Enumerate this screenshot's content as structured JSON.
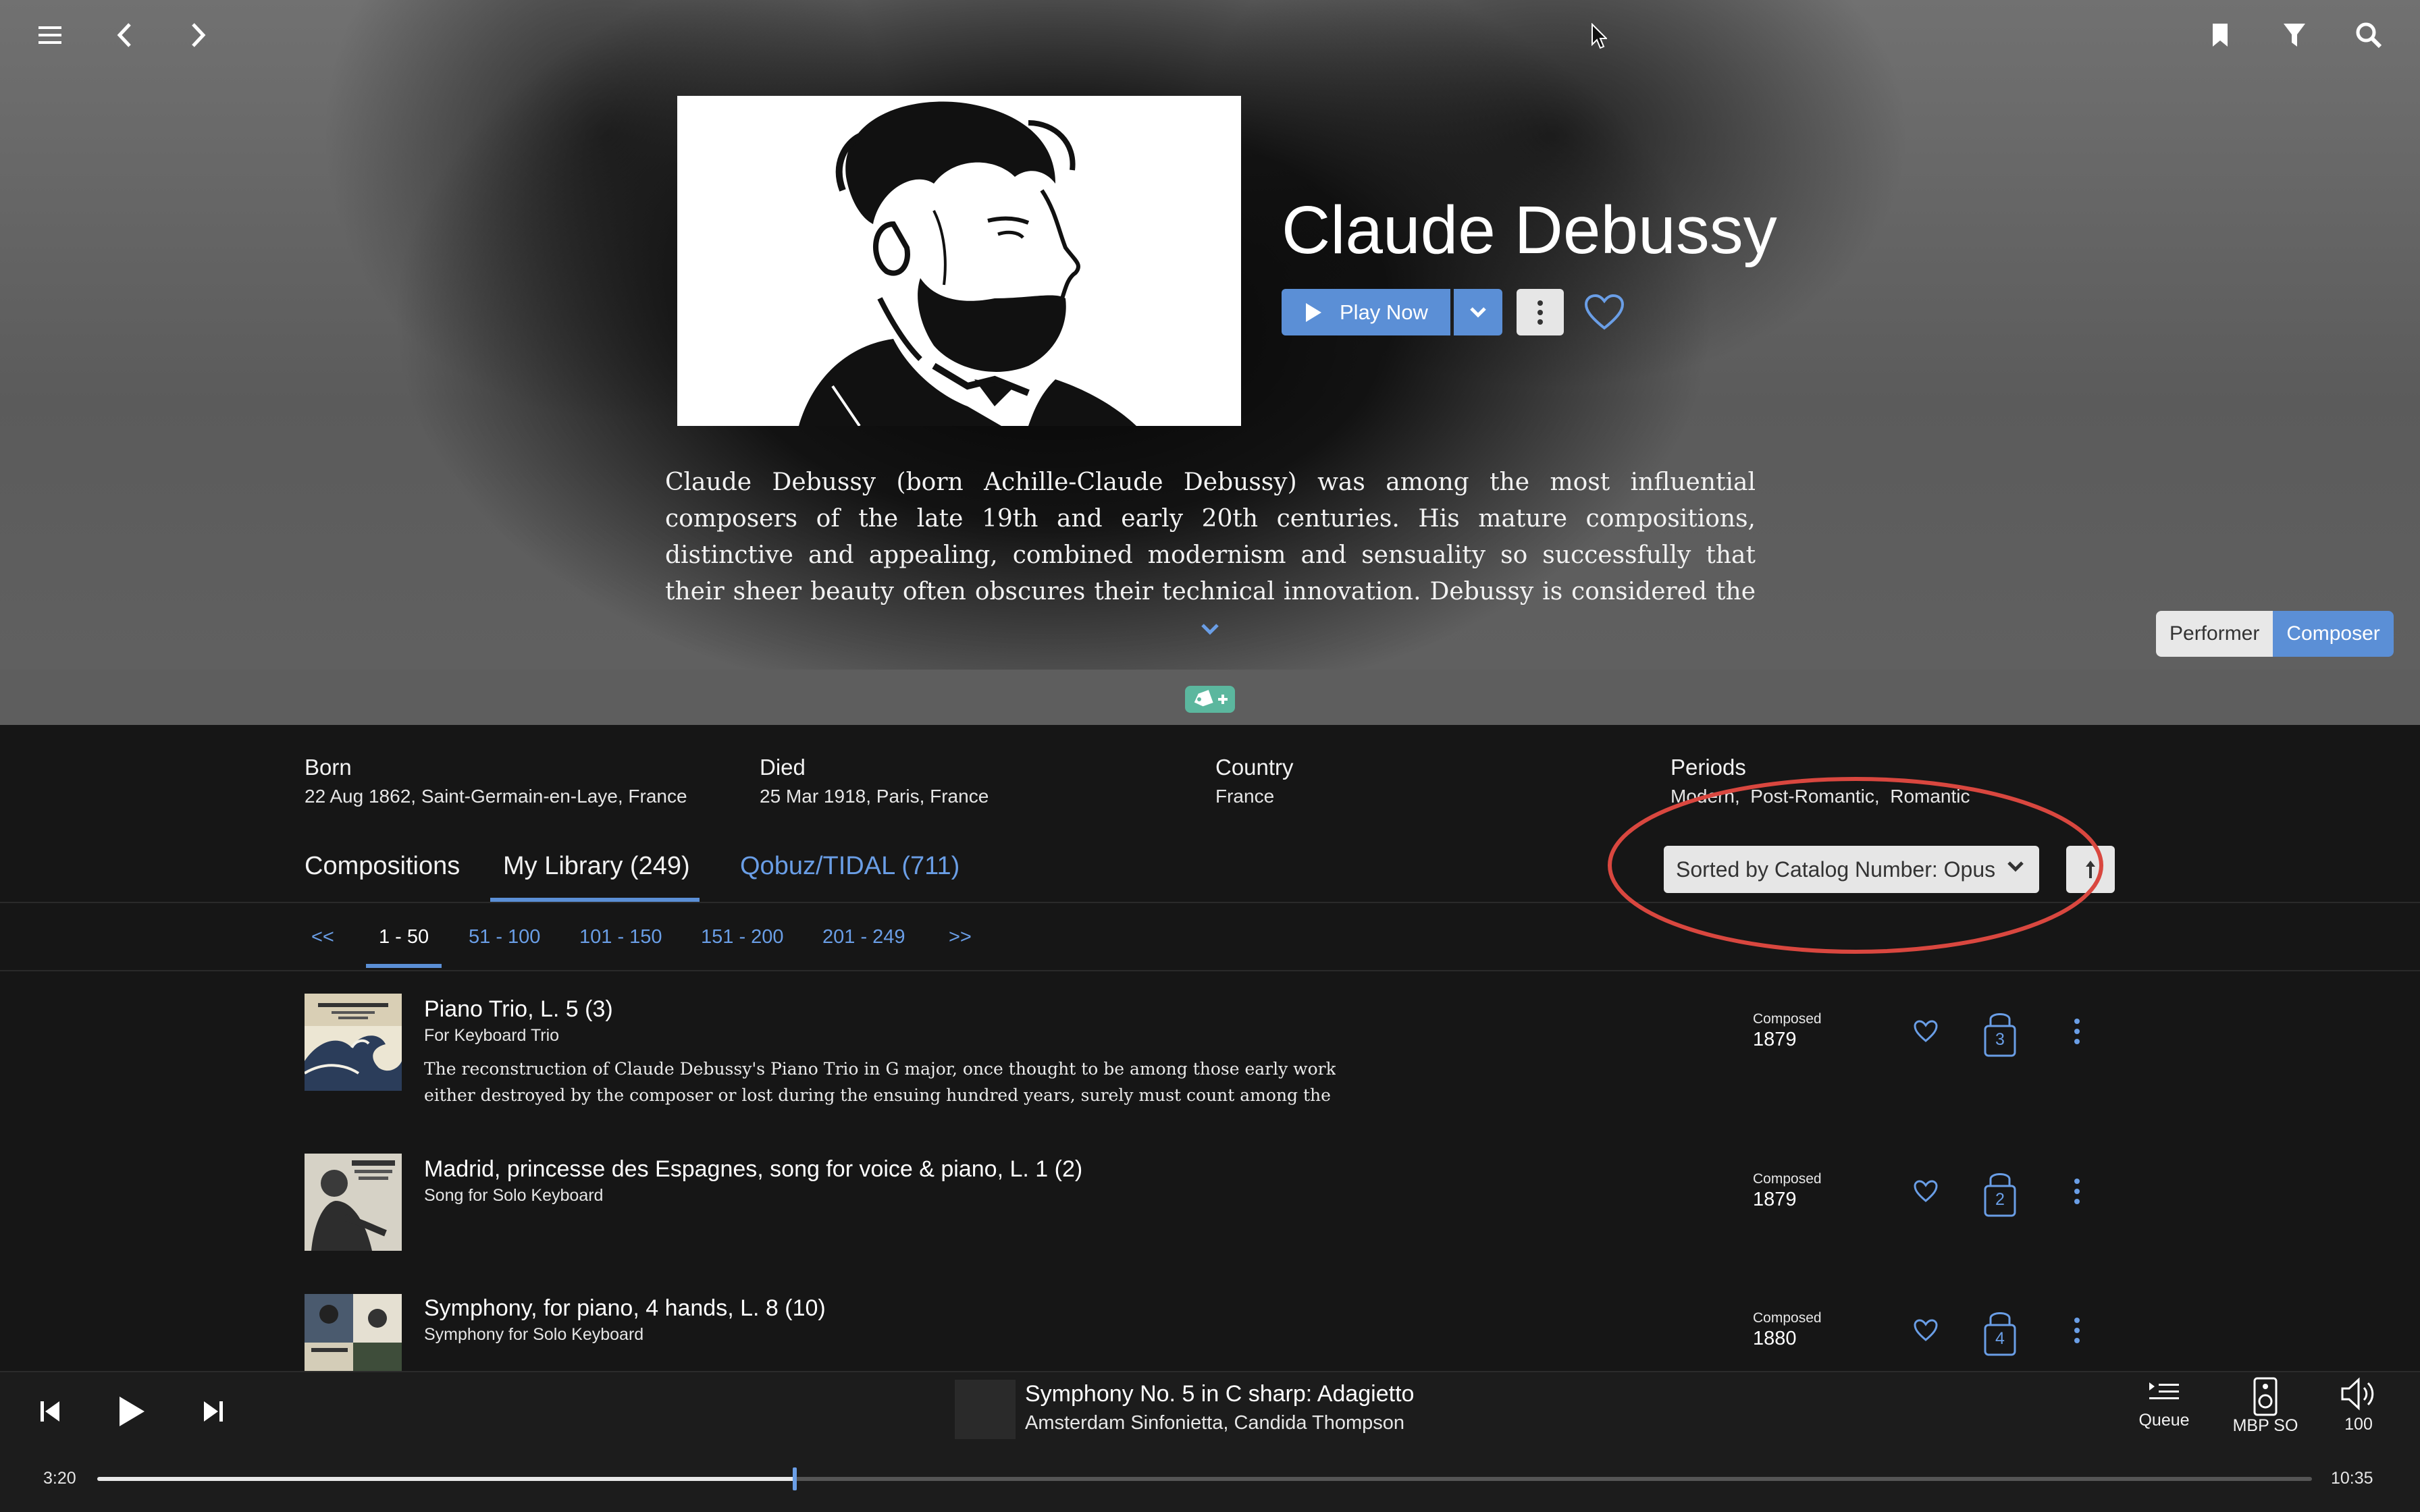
{
  "artist": {
    "name": "Claude Debussy",
    "play_label": "Play Now",
    "bio": "Claude Debussy (born Achille-Claude Debussy) was among the most influential composers of the late 19th and early 20th centuries. His mature compositions, distinctive and appealing, combined modernism and sensuality so successfully that their sheer beauty often obscures their technical innovation. Debussy is considered the founder and leading exponent of"
  },
  "role_toggle": {
    "performer": "Performer",
    "composer": "Composer"
  },
  "info": {
    "born_label": "Born",
    "born_value": "22 Aug 1862, Saint-Germain-en-Laye, France",
    "died_label": "Died",
    "died_value": "25 Mar 1918, Paris, France",
    "country_label": "Country",
    "country_value": "France",
    "periods_label": "Periods",
    "periods_value": "Modern,  Post-Romantic,  Romantic"
  },
  "tabs": {
    "compositions": "Compositions",
    "my_library": "My Library (249)",
    "streaming": "Qobuz/TIDAL (711)",
    "active": "my_library"
  },
  "sort": {
    "label": "Sorted by Catalog Number: Opus"
  },
  "pagination": {
    "prev": "<<",
    "pages": [
      "1 - 50",
      "51 - 100",
      "101 - 150",
      "151 - 200",
      "201 - 249"
    ],
    "next": ">>",
    "active": "1 - 50"
  },
  "compositions": [
    {
      "title": "Piano Trio, L. 5 (3)",
      "subtitle": "For Keyboard Trio",
      "desc1": "The reconstruction of Claude Debussy's Piano Trio in G major, once thought to be among those early works",
      "desc2": "either destroyed by the composer or lost during the ensuing hundred years, surely must count among the",
      "composed_label": "Composed",
      "year": "1879",
      "versions": "3"
    },
    {
      "title": "Madrid, princesse des Espagnes, song for voice & piano, L. 1 (2)",
      "subtitle": "Song for Solo Keyboard",
      "composed_label": "Composed",
      "year": "1879",
      "versions": "2"
    },
    {
      "title": "Symphony, for piano, 4 hands, L. 8 (10)",
      "subtitle": "Symphony for Solo Keyboard",
      "composed_label": "Composed",
      "year": "1880",
      "versions": "4"
    }
  ],
  "player": {
    "track_title": "Symphony No. 5 in C sharp: Adagietto",
    "track_artist": "Amsterdam Sinfonietta, Candida Thompson",
    "elapsed": "3:20",
    "total": "10:35",
    "progress": 0.315,
    "queue_label": "Queue",
    "zone_label": "MBP SO",
    "volume_label": "100"
  },
  "colors": {
    "accent": "#5b8fd6",
    "link": "#6a9ee6",
    "tag": "#5bb79e",
    "highlight": "#d9473f"
  },
  "icons": [
    "menu-icon",
    "back-icon",
    "forward-icon",
    "bookmark-icon",
    "filter-icon",
    "search-icon",
    "play-icon",
    "chevron-down-icon",
    "more-vertical-icon",
    "heart-icon",
    "tag-add-icon",
    "sort-direction-icon",
    "lock-icon",
    "skip-previous-icon",
    "skip-next-icon",
    "queue-icon",
    "speaker-icon",
    "volume-icon",
    "cursor-icon"
  ]
}
